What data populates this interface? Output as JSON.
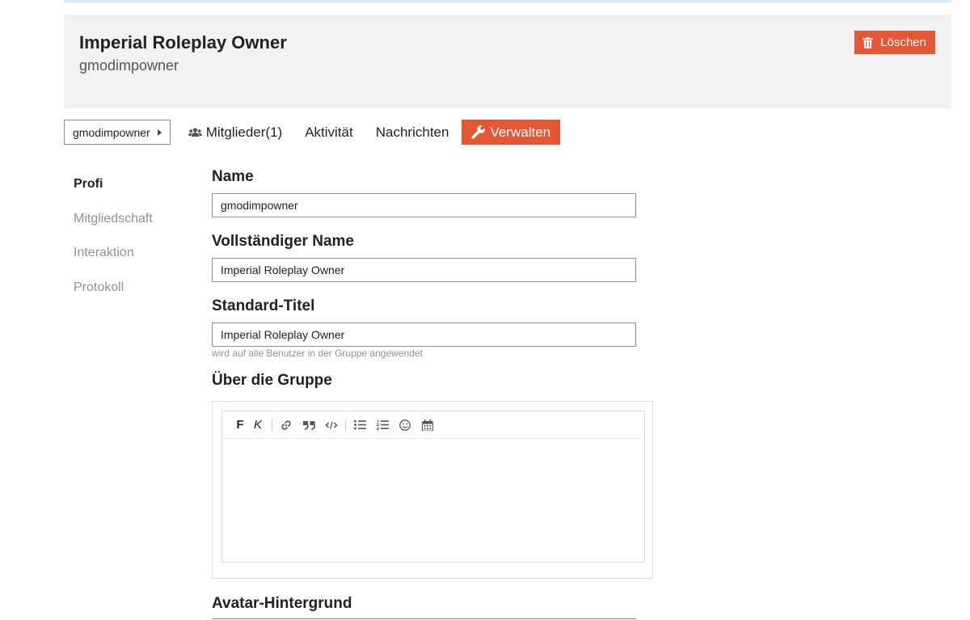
{
  "header": {
    "title": "Imperial Roleplay Owner",
    "subtitle": "gmodimpowner",
    "delete_label": "Löschen"
  },
  "nav": {
    "breadcrumb": "gmodimpowner",
    "links": [
      "Mitglieder(1)",
      "Aktivität",
      "Nachrichten",
      "Verwalten"
    ]
  },
  "sidebar": {
    "items": [
      "Profi",
      "Mitgliedschaft",
      "Interaktion",
      "Protokoll"
    ]
  },
  "form": {
    "name_label": "Name",
    "name_value": "gmodimpowner",
    "full_name_label": "Vollständiger Name",
    "full_name_value": "Imperial Roleplay Owner",
    "default_title_label": "Standard-Titel",
    "default_title_value": "Imperial Roleplay Owner",
    "default_title_hint": "wird auf alle Benutzer in der Gruppe angewendet",
    "about_label": "Über die Gruppe",
    "avatar_bg_label": "Avatar-Hintergrund"
  },
  "editor": {
    "bold_label": "F",
    "italic_label": "K",
    "icons": [
      "link-icon",
      "quote-icon",
      "code-icon",
      "bullet-list-icon",
      "numbered-list-icon",
      "emoji-icon",
      "calendar-icon"
    ]
  },
  "colors": {
    "accent": "#e45735",
    "header_bg": "#f2f2f2",
    "top_strip": "#d2ecf7"
  }
}
